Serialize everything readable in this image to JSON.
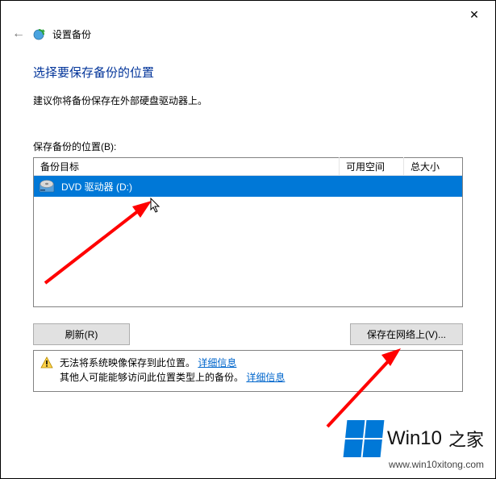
{
  "titlebar": {
    "close": "✕"
  },
  "header": {
    "back": "←",
    "title": "设置备份"
  },
  "heading": "选择要保存备份的位置",
  "subtext": "建议你将备份保存在外部硬盘驱动器上。",
  "list_label": "保存备份的位置(B):",
  "table": {
    "col_target": "备份目标",
    "col_free": "可用空间",
    "col_total": "总大小",
    "rows": [
      {
        "name": "DVD 驱动器 (D:)",
        "selected": true
      }
    ]
  },
  "buttons": {
    "refresh": "刷新(R)",
    "network": "保存在网络上(V)..."
  },
  "warning": {
    "line1_pre": "无法将系统映像保存到此位置。",
    "line1_link": "详细信息",
    "line2_pre": "其他人可能能够访问此位置类型上的备份。",
    "line2_link": "详细信息"
  },
  "watermark": {
    "brand": "Win10",
    "suffix": "之家",
    "url": "www.win10xitong.com"
  }
}
